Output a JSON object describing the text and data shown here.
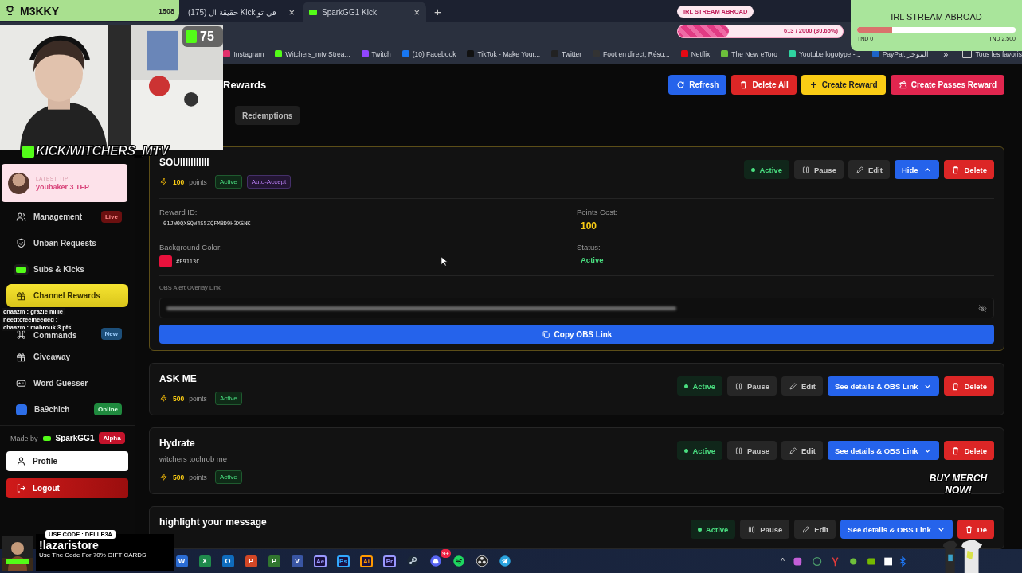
{
  "browser": {
    "tabs": [
      {
        "label": "(175) حقيقة ال Kick في تو",
        "close": "×",
        "selected": false
      },
      {
        "label": "SparkGG1 Kick",
        "close": "×",
        "selected": true
      }
    ],
    "new_tab": "+",
    "bookmarks": [
      {
        "label": "Instagram",
        "color": "#e1306c"
      },
      {
        "label": "Witchers_mtv Strea...",
        "color": "#53fc18"
      },
      {
        "label": "Twitch",
        "color": "#9146ff"
      },
      {
        "label": "(10) Facebook",
        "color": "#1877f2"
      },
      {
        "label": "TikTok - Make Your...",
        "color": "#111111"
      },
      {
        "label": "Twitter",
        "color": "#222222"
      },
      {
        "label": "Foot en direct, Résu...",
        "color": "#333333"
      },
      {
        "label": "Netflix",
        "color": "#e50914"
      },
      {
        "label": "The New eToro",
        "color": "#6cbf3b"
      },
      {
        "label": "Youtube logotype -...",
        "color": "#2fd3a0"
      },
      {
        "label": "PayPal: الموجز",
        "color": "#1d64c9"
      }
    ],
    "bookmarks_more": "»",
    "all_bookmarks": "Tous les favoris"
  },
  "sidebar": {
    "items": [
      {
        "label": "Management",
        "badge": {
          "text": "Live",
          "kind": "live"
        },
        "selected": false
      },
      {
        "label": "Unban Requests",
        "selected": false
      },
      {
        "label": "Subs & Kicks",
        "selected": false
      },
      {
        "label": "Channel Rewards",
        "selected": true
      },
      {
        "label": "Commands",
        "badge": {
          "text": "New",
          "kind": "new"
        },
        "selected": false
      },
      {
        "label": "Giveaway",
        "selected": false
      },
      {
        "label": "Word Guesser",
        "selected": false
      },
      {
        "label": "Ba9chich",
        "badge": {
          "text": "Online",
          "kind": "online"
        },
        "selected": false
      }
    ],
    "made_by": "Made by",
    "maker": "SparkGG1",
    "maker_badge": "Alpha",
    "profile": "Profile",
    "logout": "Logout"
  },
  "header": {
    "title": "Rewards",
    "buttons": [
      {
        "label": "Refresh",
        "kind": "refresh"
      },
      {
        "label": "Delete All",
        "kind": "delete"
      },
      {
        "label": "Create Reward",
        "kind": "create"
      },
      {
        "label": "Create Passes Reward",
        "kind": "passes"
      }
    ],
    "tabs": [
      {
        "label": "Redemptions",
        "selected": false
      }
    ]
  },
  "rewards": [
    {
      "title": "SOUIIIIIIIIIII",
      "points": "100",
      "points_label": "points",
      "status": "Active",
      "tags": [
        "Auto-Accept"
      ],
      "expanded": true,
      "actions": {
        "status": "Active",
        "pause": "Pause",
        "edit": "Edit",
        "toggle": "Hide",
        "delete": "Delete"
      },
      "details": {
        "id_label": "Reward ID:",
        "id": "01JW0QXSQW4S5ZQFM8D9H3XSNK",
        "cost_label": "Points Cost:",
        "cost": "100",
        "color_label": "Background Color:",
        "color_text": "#E9113C",
        "color": "#e9113c",
        "status_label": "Status:",
        "status": "Active",
        "obs_label": "OBS Alert Overlay Link",
        "copy": "Copy OBS Link"
      }
    },
    {
      "title": "ASK ME",
      "points": "500",
      "points_label": "points",
      "status": "Active",
      "expanded": false,
      "actions": {
        "status": "Active",
        "pause": "Pause",
        "edit": "Edit",
        "toggle": "See details & OBS Link",
        "delete": "Delete"
      }
    },
    {
      "title": "Hydrate",
      "description": "witchers tochrob me",
      "points": "500",
      "points_label": "points",
      "status": "Active",
      "expanded": false,
      "actions": {
        "status": "Active",
        "pause": "Pause",
        "edit": "Edit",
        "toggle": "See details & OBS Link",
        "delete": "Delete"
      }
    },
    {
      "title": "highlight your message",
      "expanded": false,
      "actions": {
        "status": "Active",
        "pause": "Pause",
        "edit": "Edit",
        "toggle": "See details & OBS Link",
        "delete": "De"
      }
    }
  ],
  "taskbar": {
    "apps": [
      {
        "kind": "office",
        "glyph": "W",
        "color": "#2b6cd4"
      },
      {
        "kind": "office",
        "glyph": "X",
        "color": "#1f8a4c"
      },
      {
        "kind": "office",
        "glyph": "O",
        "color": "#0f6cbd"
      },
      {
        "kind": "office",
        "glyph": "P",
        "color": "#d24726"
      },
      {
        "kind": "office",
        "glyph": "P",
        "color": "#31752f"
      },
      {
        "kind": "office",
        "glyph": "V",
        "color": "#3955a3"
      },
      {
        "kind": "adobe",
        "glyph": "Ae",
        "color": "#9999ff"
      },
      {
        "kind": "adobe",
        "glyph": "Ps",
        "color": "#31a8ff"
      },
      {
        "kind": "adobe",
        "glyph": "Ai",
        "color": "#ff9a00"
      },
      {
        "kind": "adobe",
        "glyph": "Pr",
        "color": "#9999ff"
      },
      {
        "kind": "steam"
      },
      {
        "kind": "discord",
        "badge": "9+"
      },
      {
        "kind": "spotify"
      },
      {
        "kind": "obs"
      },
      {
        "kind": "telegram"
      }
    ],
    "tray_more": "^"
  },
  "overlays": {
    "follower_goal": {
      "name": "M3KKY",
      "count": "1508"
    },
    "viewer_badge": {
      "count": "75"
    },
    "banner": "KICK/WITCHERS_MTV",
    "latest_tip": {
      "heading": "LATEST TIP",
      "text": "youbaker 3 TFP"
    },
    "chat": [
      {
        "text": "chaazm : grazie mille"
      },
      {
        "text": "needtofeelneeded :"
      },
      {
        "text": "chaazm : mabrouk 3 pts"
      }
    ],
    "goal_bar": {
      "title": "IRL STREAM ABROAD",
      "reading": "613 / 2000 (30.65%)",
      "level": 0.31
    },
    "goal_card": {
      "title": "IRL STREAM ABROAD",
      "level": 0.22,
      "min": "TND 0",
      "max": "TND 2,500"
    },
    "merch": [
      "BUY MERCH",
      "NOW!"
    ],
    "promo": {
      "code": "USE CODE : DELLE3A",
      "title": "!lazaristore",
      "text": "Use The Code For 70% GIFT CARDS"
    }
  }
}
